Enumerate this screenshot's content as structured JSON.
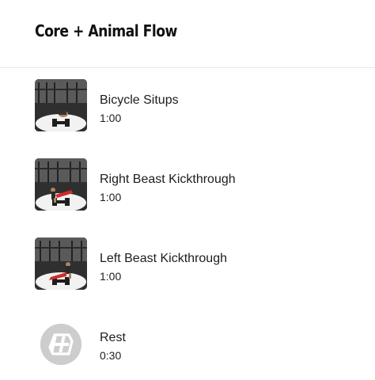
{
  "header": {
    "title": "Core + Animal Flow"
  },
  "exercises": [
    {
      "name": "Bicycle Situps",
      "duration": "1:00",
      "thumb_icon": "exercise-video-thumbnail"
    },
    {
      "name": "Right Beast Kickthrough",
      "duration": "1:00",
      "thumb_icon": "exercise-video-thumbnail"
    },
    {
      "name": "Left Beast Kickthrough",
      "duration": "1:00",
      "thumb_icon": "exercise-video-thumbnail"
    },
    {
      "name": "Rest",
      "duration": "0:30",
      "thumb_icon": "rest-logo-icon"
    }
  ],
  "colors": {
    "text": "#1d1d1d",
    "divider": "#e6e6e6",
    "rest_icon_bg": "#cfcfcf",
    "athlete_red": "#d42a2a"
  }
}
